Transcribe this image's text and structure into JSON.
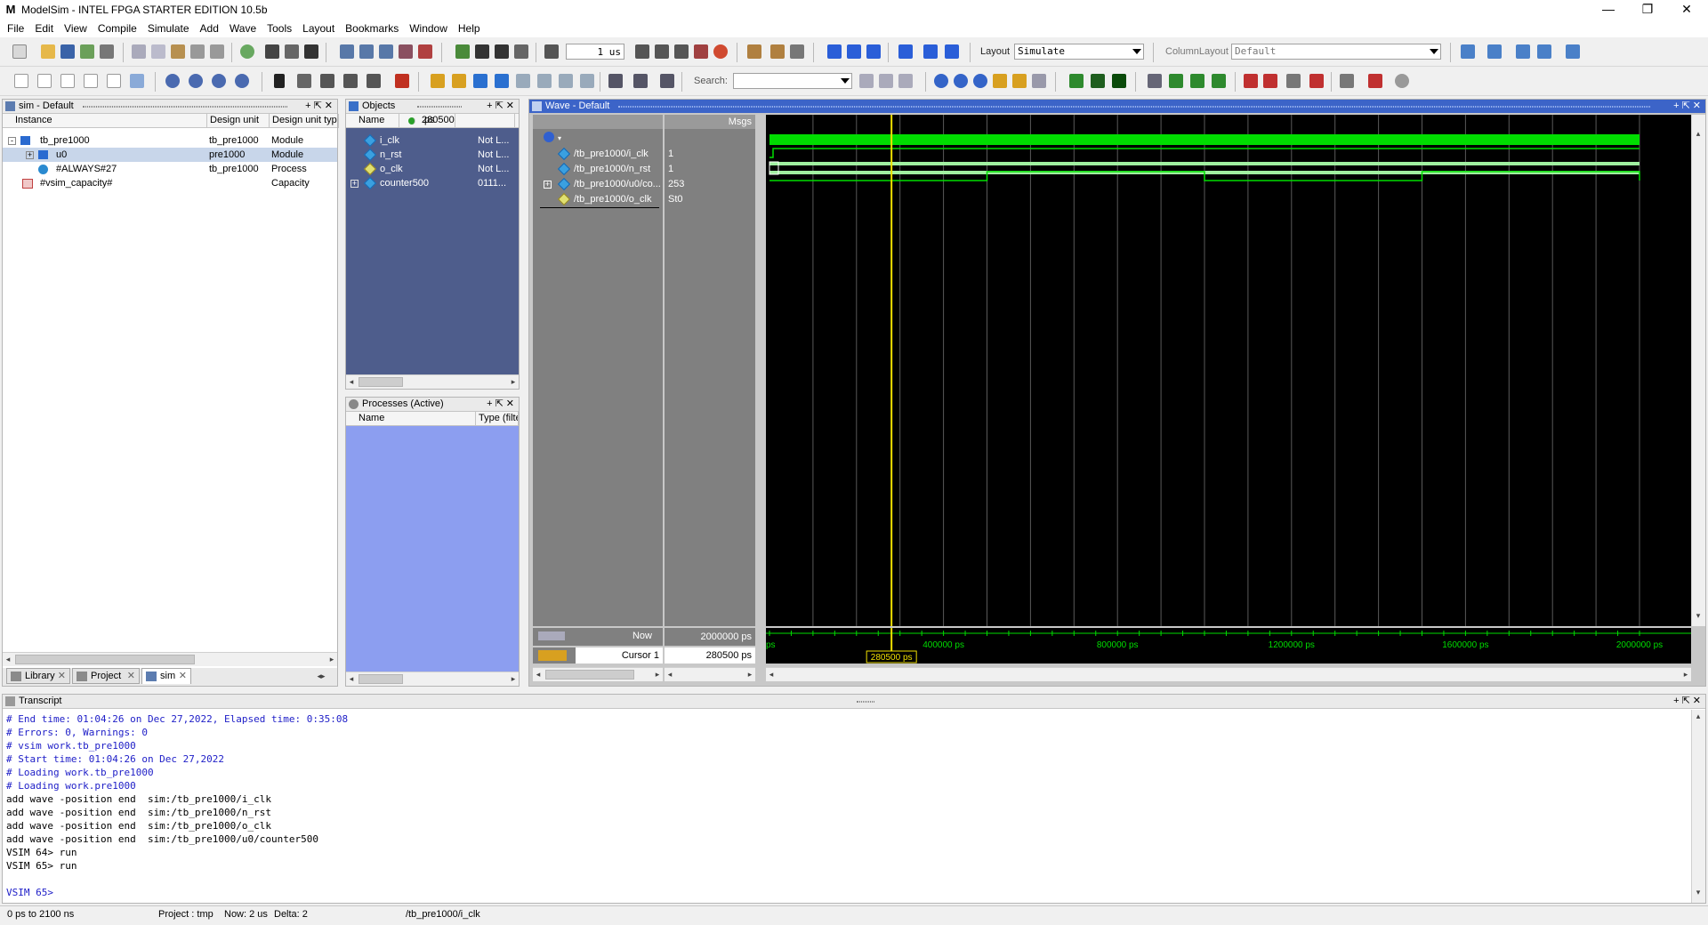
{
  "window": {
    "title": "ModelSim - INTEL FPGA STARTER EDITION 10.5b"
  },
  "menu": [
    "File",
    "Edit",
    "View",
    "Compile",
    "Simulate",
    "Add",
    "Wave",
    "Tools",
    "Layout",
    "Bookmarks",
    "Window",
    "Help"
  ],
  "toolbar": {
    "run_length": "1 us",
    "layout_label": "Layout",
    "layout_value": "Simulate",
    "column_layout_label": "ColumnLayout",
    "column_layout_value": "Default",
    "search_label": "Search:"
  },
  "sim_pane": {
    "title": "sim - Default",
    "columns": [
      "Instance",
      "Design unit",
      "Design unit typ"
    ],
    "rows": [
      {
        "instance": "tb_pre1000",
        "unit": "tb_pre1000",
        "type": "Module"
      },
      {
        "instance": "u0",
        "unit": "pre1000",
        "type": "Module"
      },
      {
        "instance": "#ALWAYS#27",
        "unit": "tb_pre1000",
        "type": "Process"
      },
      {
        "instance": "#vsim_capacity#",
        "unit": "",
        "type": "Capacity"
      }
    ],
    "tabs": [
      "Library",
      "Project",
      "sim"
    ]
  },
  "objects_pane": {
    "title": "Objects",
    "time_value": "280500",
    "time_unit": "ps",
    "columns": [
      "Name",
      "Value"
    ],
    "rows": [
      {
        "name": "i_clk",
        "value": "Not L..."
      },
      {
        "name": "n_rst",
        "value": "Not L..."
      },
      {
        "name": "o_clk",
        "value": "Not L..."
      },
      {
        "name": "counter500",
        "value": "0111..."
      }
    ]
  },
  "processes_pane": {
    "title": "Processes (Active)",
    "columns": [
      "Name",
      "Type (filte"
    ]
  },
  "wave": {
    "title": "Wave - Default",
    "msgs_header": "Msgs",
    "signals": [
      {
        "name": "/tb_pre1000/i_clk",
        "value": "1"
      },
      {
        "name": "/tb_pre1000/n_rst",
        "value": "1"
      },
      {
        "name": "/tb_pre1000/u0/co...",
        "value": "253"
      },
      {
        "name": "/tb_pre1000/o_clk",
        "value": "St0"
      }
    ],
    "now_label": "Now",
    "now_value": "2000000 ps",
    "cursor_label": "Cursor 1",
    "cursor_value": "280500 ps",
    "cursor_marker": "280500 ps",
    "ruler_start": "ps",
    "ruler_labels": [
      "400000 ps",
      "800000 ps",
      "1200000 ps",
      "1600000 ps",
      "2000000 ps"
    ],
    "time_end_ps": 2000000,
    "cursor_ps": 280500,
    "o_clk_rise_ps": [
      500000,
      1500000
    ],
    "o_clk_fall_ps": [
      1000000,
      2000000
    ],
    "colors": {
      "bg": "#000000",
      "signal": "#00dd00",
      "bus": "#a0f0a0",
      "cursor": "#f0e000",
      "grid": "#5a5a5a"
    }
  },
  "transcript": {
    "title": "Transcript",
    "lines": [
      {
        "text": "# End time: 01:04:26 on Dec 27,2022, Elapsed time: 0:35:08",
        "kind": "blue"
      },
      {
        "text": "# Errors: 0, Warnings: 0",
        "kind": "blue"
      },
      {
        "text": "# vsim work.tb_pre1000",
        "kind": "blue"
      },
      {
        "text": "# Start time: 01:04:26 on Dec 27,2022",
        "kind": "blue"
      },
      {
        "text": "# Loading work.tb_pre1000",
        "kind": "blue"
      },
      {
        "text": "# Loading work.pre1000",
        "kind": "blue"
      },
      {
        "text": "add wave -position end  sim:/tb_pre1000/i_clk",
        "kind": "blk"
      },
      {
        "text": "add wave -position end  sim:/tb_pre1000/n_rst",
        "kind": "blk"
      },
      {
        "text": "add wave -position end  sim:/tb_pre1000/o_clk",
        "kind": "blk"
      },
      {
        "text": "add wave -position end  sim:/tb_pre1000/u0/counter500",
        "kind": "blk"
      },
      {
        "text": "VSIM 64> run",
        "kind": "blk"
      },
      {
        "text": "VSIM 65> run",
        "kind": "blk"
      },
      {
        "text": "",
        "kind": "blk"
      },
      {
        "text": "VSIM 65>",
        "kind": "prompt"
      }
    ]
  },
  "status": {
    "time_range": "0 ps to 2100 ns",
    "project": "Project : tmp",
    "now": "Now: 2 us",
    "delta": "Delta: 2",
    "path": "/tb_pre1000/i_clk"
  }
}
